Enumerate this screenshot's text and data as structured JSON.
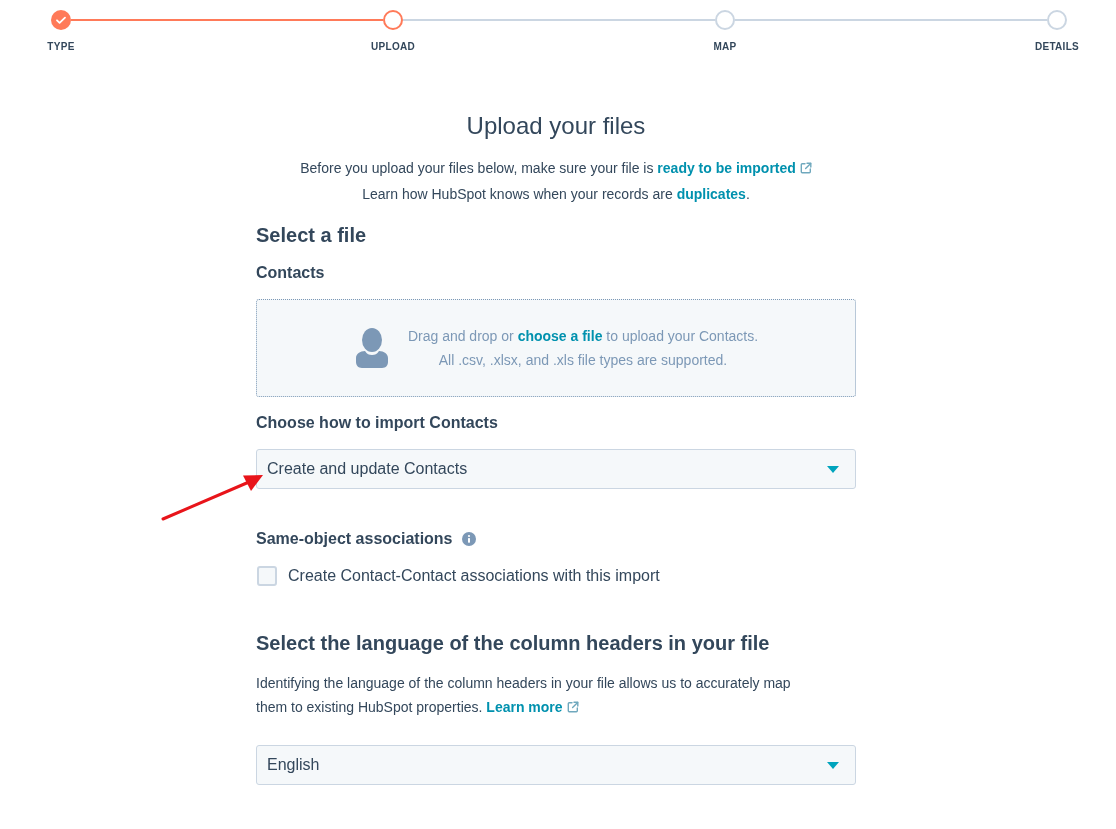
{
  "stepper": {
    "steps": [
      {
        "label": "TYPE",
        "completed": true,
        "current": false
      },
      {
        "label": "UPLOAD",
        "completed": false,
        "current": true
      },
      {
        "label": "MAP",
        "completed": false,
        "current": false
      },
      {
        "label": "DETAILS",
        "completed": false,
        "current": false
      }
    ]
  },
  "page": {
    "title": "Upload your files",
    "intro": [
      {
        "text": "Before you upload your files below, make sure your file is",
        "link": "ready to be imported",
        "external": true
      },
      {
        "text": "Learn how HubSpot knows when your records are",
        "link": "duplicates",
        "after": "."
      }
    ]
  },
  "file_section": {
    "heading": "Select a file",
    "object_label": "Contacts",
    "dropzone": {
      "text_before": "Drag and drop or",
      "link": "choose a file",
      "text_after": "to upload your Contacts.",
      "hint": "All .csv, .xlsx, and .xls file types are supported."
    }
  },
  "import_mode": {
    "label": "Choose how to import Contacts",
    "value": "Create and update Contacts"
  },
  "associations": {
    "label": "Same-object associations",
    "checkbox": {
      "label": "Create Contact-Contact associations with this import",
      "checked": false
    }
  },
  "language_section": {
    "heading": "Select the language of the column headers in your file",
    "description": "Identifying the language of the column headers in your file allows us to accurately map them to existing HubSpot properties.",
    "link": "Learn more",
    "external": true,
    "select": {
      "value": "English"
    }
  }
}
